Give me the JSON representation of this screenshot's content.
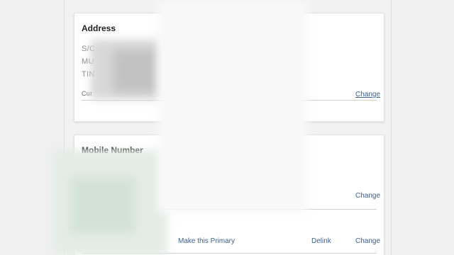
{
  "address_card": {
    "title": "Address",
    "line1": "S/C",
    "line2": "MU",
    "line3": "TIN",
    "line4": "Cur",
    "change_link": "Change"
  },
  "mobile_card": {
    "title": "Mobile Number",
    "change_link_1": "Change",
    "make_primary_link": "Make this Primary",
    "delink_link": "Delink",
    "change_link_2": "Change"
  },
  "colors": {
    "link": "#3a5f8f",
    "card_bg": "#ffffff",
    "page_bg": "#f2f2f2"
  }
}
